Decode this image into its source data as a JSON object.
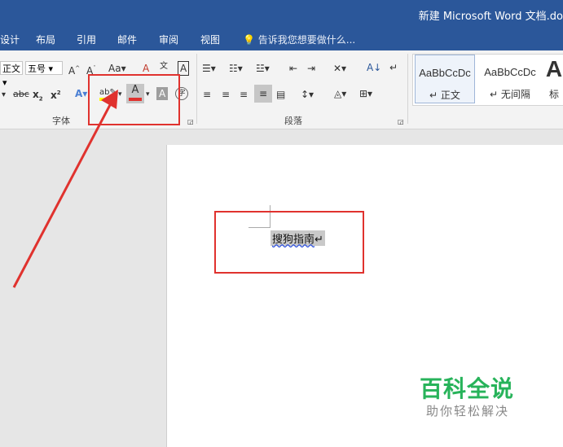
{
  "title": "新建 Microsoft Word 文档.do",
  "menu": {
    "tabs": [
      "设计",
      "布局",
      "引用",
      "邮件",
      "审阅",
      "视图"
    ],
    "tell_me": "告诉我您想要做什么..."
  },
  "font": {
    "name_value": "正文",
    "size_value": "五号",
    "group_label": "字体",
    "case_label": "Aa",
    "strike_label": "abc",
    "highlight_color": "#ffff00",
    "font_color": "#e0322e"
  },
  "paragraph": {
    "group_label": "段落"
  },
  "styles": [
    {
      "sample": "AaBbCcDc",
      "name": "正文"
    },
    {
      "sample": "AaBbCcDc",
      "name": "无间隔"
    },
    {
      "sample": "A",
      "name": "标"
    }
  ],
  "document": {
    "text": "搜狗指南"
  },
  "watermark": {
    "title": "百科全说",
    "subtitle": "助你轻松解决"
  },
  "annotation": {
    "color": "#e0322e"
  }
}
